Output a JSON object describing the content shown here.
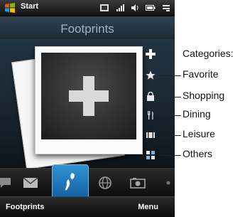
{
  "status_bar": {
    "start_label": "Start",
    "icons": [
      "windows-logo-icon",
      "message-icon",
      "signal-icon",
      "volume-icon",
      "battery-icon",
      "connectivity-icon"
    ]
  },
  "screen": {
    "title": "Footprints"
  },
  "side_buttons": [
    {
      "icon": "add-icon"
    },
    {
      "icon": "favorite-star-icon"
    },
    {
      "icon": "shopping-bag-icon"
    },
    {
      "icon": "dining-icon"
    },
    {
      "icon": "leisure-icon"
    },
    {
      "icon": "others-icon"
    }
  ],
  "tabs": [
    {
      "icon": "call-history-icon"
    },
    {
      "icon": "mail-icon"
    },
    {
      "icon": "footprints-icon",
      "active": true
    },
    {
      "icon": "internet-icon"
    },
    {
      "icon": "camera-icon"
    }
  ],
  "softkeys": {
    "left": "Footprints",
    "right": "Menu"
  },
  "callouts": {
    "heading": "Categories:",
    "items": [
      "Favorite",
      "Shopping",
      "Dining",
      "Leisure",
      "Others"
    ]
  },
  "colors": {
    "accent": "#2a8cd0",
    "title_text": "#9fb4c2"
  }
}
